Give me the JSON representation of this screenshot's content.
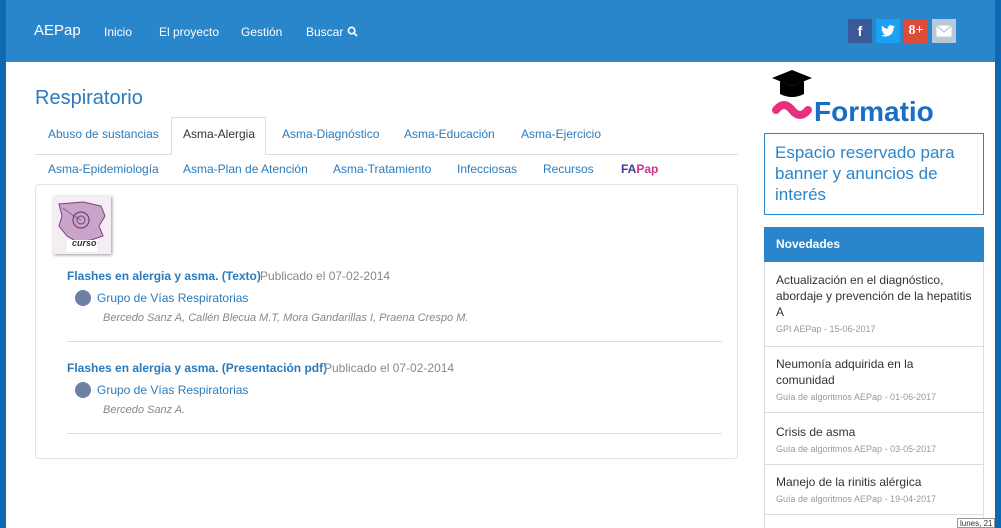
{
  "navbar": {
    "brand": "AEPap",
    "links": [
      "Inicio",
      "El proyecto",
      "Gestión",
      "Buscar"
    ],
    "social": [
      "f",
      "t",
      "8+",
      "mail"
    ]
  },
  "page": {
    "title": "Respiratorio"
  },
  "tabs": [
    "Abuso de sustancias",
    "Asma-Alergia",
    "Asma-Diagnóstico",
    "Asma-Educación",
    "Asma-Ejercicio",
    "Asma-Epidemiología",
    "Asma-Plan de Atención",
    "Asma-Tratamiento",
    "Infecciosas",
    "Recursos"
  ],
  "fapap": {
    "fa": "FA",
    "pap": "Pap"
  },
  "thumb": {
    "label": "curso"
  },
  "entries": [
    {
      "title": "Flashes en alergia y asma. (Texto)",
      "date": "Publicado el 07-02-2014",
      "group": "Grupo de Vías Respiratorias",
      "authors": "Bercedo Sanz A, Callén Blecua M.T, Mora Gandarillas I, Praena Crespo M."
    },
    {
      "title": "Flashes en alergia y asma. (Presentación pdf)",
      "date": "Publicado el 07-02-2014",
      "group": "Grupo de Vías Respiratorias",
      "authors": "Bercedo Sanz A."
    }
  ],
  "sidebar": {
    "logo": "Formatio",
    "banner_text": "Espacio reservado para banner y anuncios de interés",
    "novedades_title": "Novedades",
    "novedades": [
      {
        "title": "Actualización en el diagnóstico, abordaje y prevención de la hepatitis A",
        "meta": "GPI AEPap - 15-06-2017"
      },
      {
        "title": "Neumonía adquirida en la comunidad",
        "meta": "Guía de algoritmos AEPap - 01-06-2017"
      },
      {
        "title": "Crisis de asma",
        "meta": "Guía de algoritmos AEPap - 03-05-2017"
      },
      {
        "title": "Manejo de la rinitis alérgica",
        "meta": "Guía de algoritmos AEPap - 19-04-2017"
      }
    ]
  },
  "tooltip": "lunes, 21",
  "colors": {
    "navbar": "#2a86cb",
    "link": "#2a7bbd",
    "fapap_pink": "#d0318c",
    "facebook": "#3b5998",
    "twitter": "#1da1f2",
    "googleplus": "#dd4b39",
    "mail": "#b9c7d8"
  }
}
